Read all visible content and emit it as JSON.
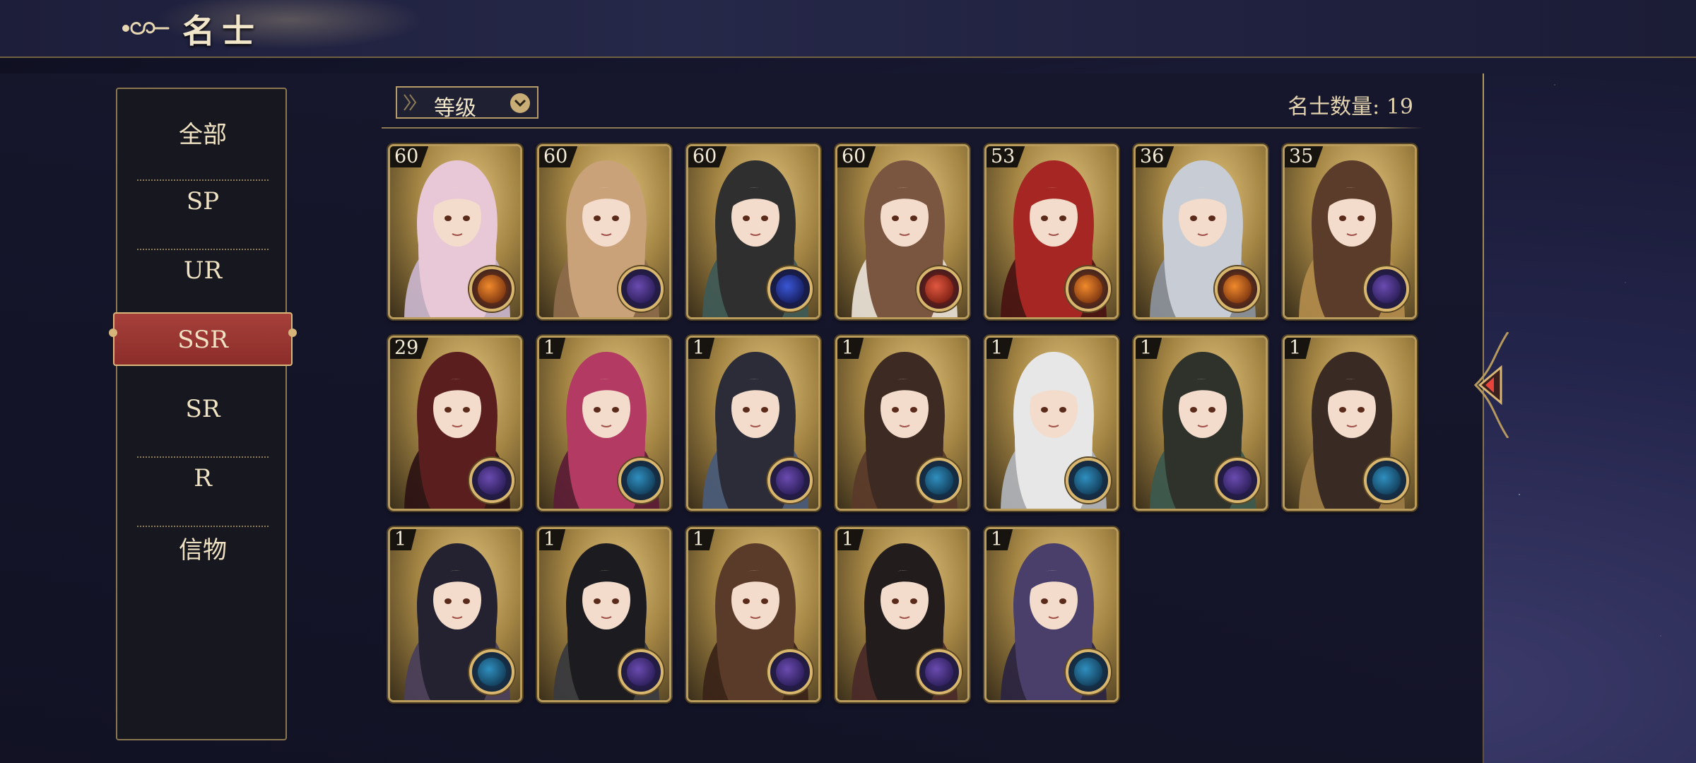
{
  "header": {
    "title": "名士"
  },
  "sidebar": {
    "items": [
      {
        "label": "全部",
        "active": false
      },
      {
        "label": "SP",
        "active": false
      },
      {
        "label": "UR",
        "active": false
      },
      {
        "label": "SSR",
        "active": true
      },
      {
        "label": "SR",
        "active": false
      },
      {
        "label": "R",
        "active": false
      },
      {
        "label": "信物",
        "active": false
      }
    ]
  },
  "filter": {
    "label": "等级",
    "icon": "chevron-down-icon"
  },
  "count": {
    "text": "名士数量: 19"
  },
  "colors": {
    "accent_gold": "#b99c5c",
    "active_tab": "#9a3532",
    "panel": "#17171f"
  },
  "cards": [
    {
      "level": "60",
      "palette": "pink-silver",
      "element": "orange-sun"
    },
    {
      "level": "60",
      "palette": "light-brown",
      "element": "purple-moon"
    },
    {
      "level": "60",
      "palette": "black-teal",
      "element": "blue-star"
    },
    {
      "level": "60",
      "palette": "brown-white",
      "element": "red-sun"
    },
    {
      "level": "53",
      "palette": "red",
      "element": "orange-sun"
    },
    {
      "level": "36",
      "palette": "silver",
      "element": "orange-sun"
    },
    {
      "level": "35",
      "palette": "brown-gold",
      "element": "purple-moon"
    },
    {
      "level": "29",
      "palette": "dark-red",
      "element": "purple-moon"
    },
    {
      "level": "1",
      "palette": "magenta",
      "element": "teal-eye"
    },
    {
      "level": "1",
      "palette": "black-blue",
      "element": "purple-moon"
    },
    {
      "level": "1",
      "palette": "dark-brown",
      "element": "teal-eye"
    },
    {
      "level": "1",
      "palette": "white",
      "element": "teal-eye"
    },
    {
      "level": "1",
      "palette": "dark-green",
      "element": "purple-moon"
    },
    {
      "level": "1",
      "palette": "dark-brown-gold",
      "element": "teal-eye"
    },
    {
      "level": "1",
      "palette": "black-purple",
      "element": "teal-eye"
    },
    {
      "level": "1",
      "palette": "black",
      "element": "purple-moon"
    },
    {
      "level": "1",
      "palette": "brown",
      "element": "purple-moon"
    },
    {
      "level": "1",
      "palette": "black-red",
      "element": "purple-moon"
    },
    {
      "level": "1",
      "palette": "purple",
      "element": "teal-eye"
    }
  ]
}
